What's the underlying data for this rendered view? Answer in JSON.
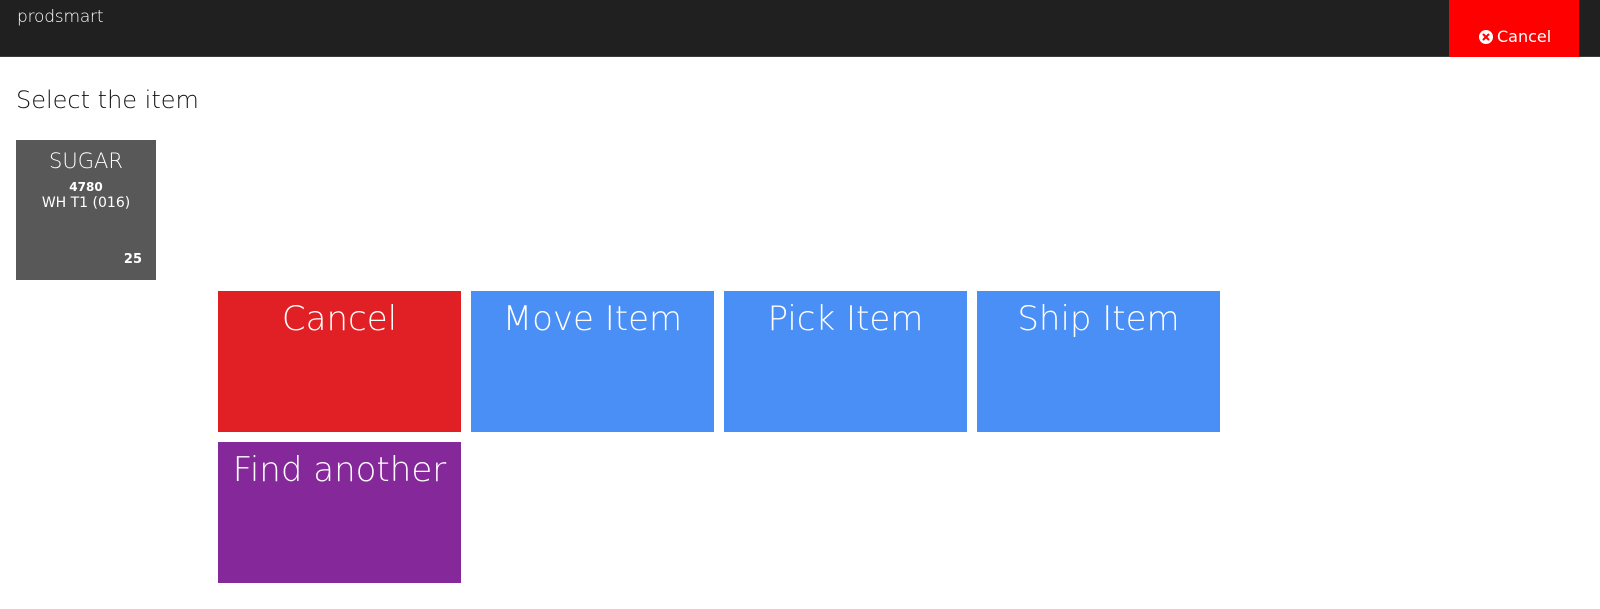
{
  "app": {
    "brand": "prodsmart"
  },
  "topbar": {
    "cancel_label": "Cancel",
    "cancel_color": "#ff0000",
    "cancel_icon": "times-circle-icon"
  },
  "page": {
    "heading": "Select the item"
  },
  "item": {
    "name": "SUGAR",
    "code": "4780",
    "location": "WH T1 (016)",
    "quantity": "25",
    "color": "#585858"
  },
  "actions": [
    {
      "label": "Cancel",
      "color": "#e02024"
    },
    {
      "label": "Move Item",
      "color": "#4a8ff5"
    },
    {
      "label": "Pick Item",
      "color": "#4a8ff5"
    },
    {
      "label": "Ship Item",
      "color": "#4a8ff5"
    },
    {
      "label": "Find another",
      "color": "#85299a"
    }
  ]
}
